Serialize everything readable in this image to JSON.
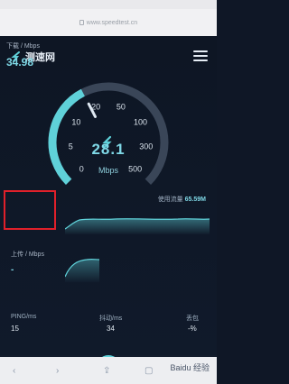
{
  "browser": {
    "url": "www.speedtest.cn"
  },
  "app": {
    "name": "测速网"
  },
  "gauge": {
    "ticks": [
      "0",
      "5",
      "10",
      "20",
      "50",
      "100",
      "300",
      "500"
    ],
    "speed_value": "28.1",
    "speed_unit": "Mbps",
    "level": 0.4,
    "accent_color": "#5fd1d9"
  },
  "download": {
    "label": "下载 / Mbps",
    "value": "34.98"
  },
  "usage": {
    "label": "使用流量",
    "value": "65.59M"
  },
  "upload": {
    "label": "上传 / Mbps",
    "value": "-"
  },
  "stats": [
    {
      "label": "PING/ms",
      "value": "15"
    },
    {
      "label": "抖动/ms",
      "value": "34"
    },
    {
      "label": "丢包",
      "value": "-%"
    }
  ],
  "watermark": "Baidu 经验"
}
